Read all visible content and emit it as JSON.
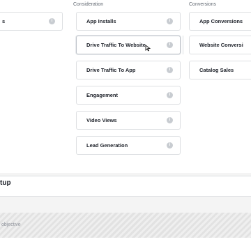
{
  "columns": {
    "consideration": "Consideration",
    "conversions": "Conversions"
  },
  "left_column": [
    {
      "label": "s"
    }
  ],
  "consideration": [
    {
      "label": "App Installs"
    },
    {
      "label": "Drive Traffic To Website"
    },
    {
      "label": "Drive Traffic To App"
    },
    {
      "label": "Engagement"
    },
    {
      "label": "Video Views"
    },
    {
      "label": "Lead Generation"
    }
  ],
  "conversions": [
    {
      "label": "App Conversions"
    },
    {
      "label": "Website Conversi"
    },
    {
      "label": "Catalog Sales"
    }
  ],
  "info_glyph": "i",
  "setup": {
    "title": "tup"
  },
  "objective": {
    "placeholder": "objective"
  }
}
